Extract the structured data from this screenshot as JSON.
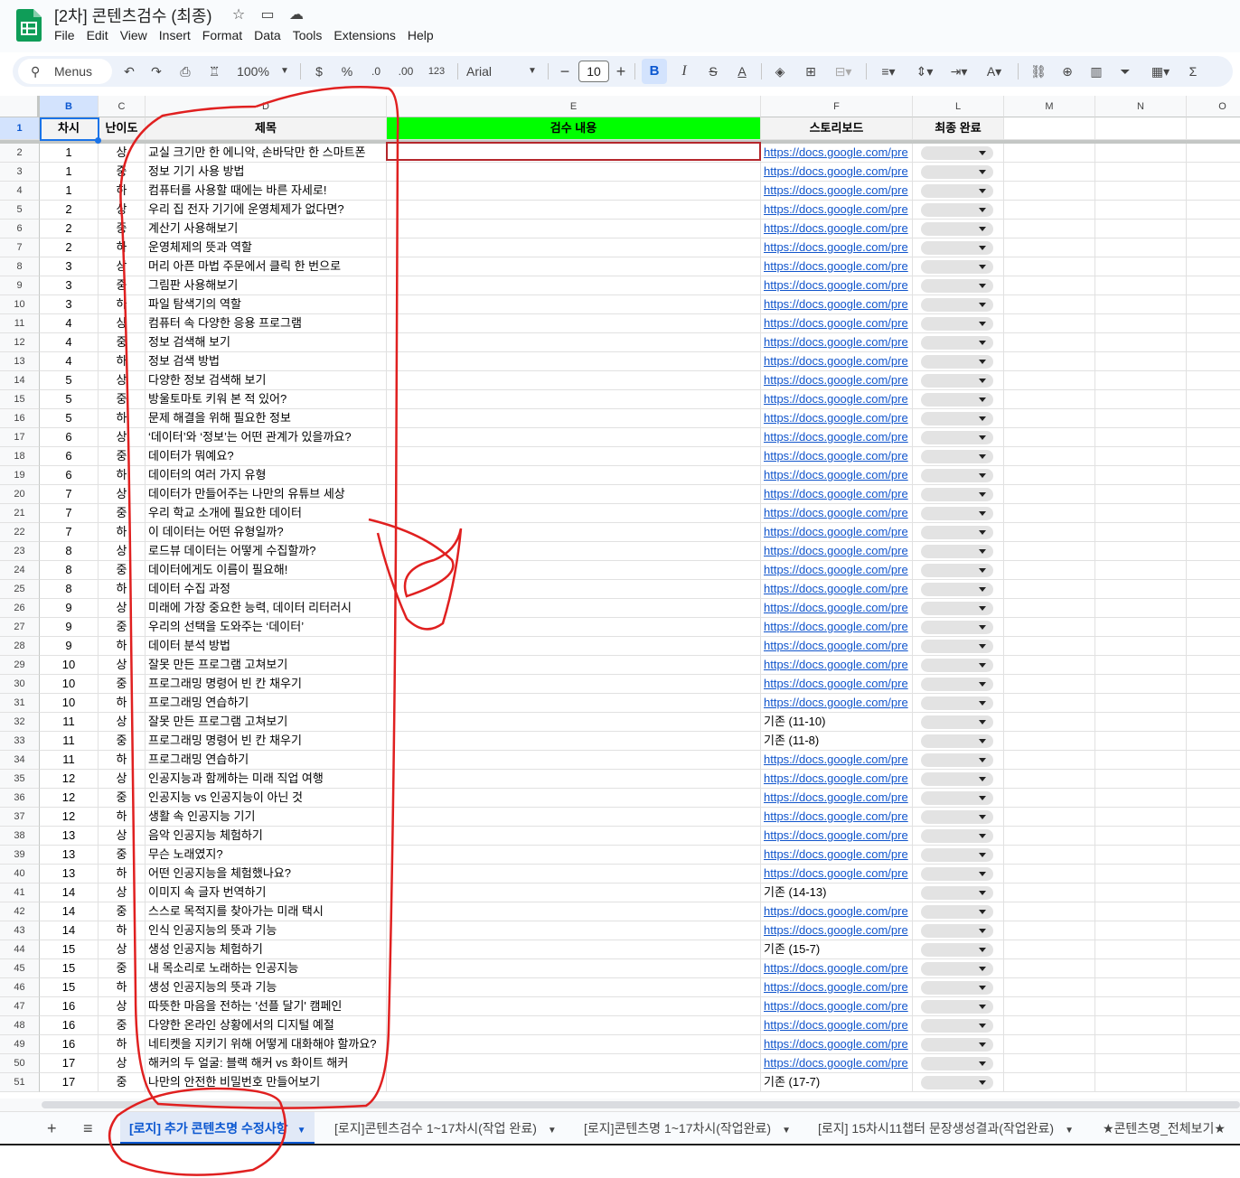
{
  "app": {
    "doc_title": "[2차] 콘텐츠검수 (최종)",
    "menu": [
      "File",
      "Edit",
      "View",
      "Insert",
      "Format",
      "Data",
      "Tools",
      "Extensions",
      "Help"
    ]
  },
  "toolbar": {
    "menus_label": "Menus",
    "zoom": "100%",
    "currency": "$",
    "percent": "%",
    "dec_decrease": ".0",
    "dec_increase": ".00",
    "number_format": "123",
    "font": "Arial",
    "font_size": "10",
    "minus": "−",
    "plus": "+",
    "bold": "B",
    "italic": "I",
    "strike": "S",
    "text_color": "A",
    "sum": "Σ"
  },
  "columns": [
    "B",
    "C",
    "D",
    "E",
    "F",
    "L",
    "M",
    "N",
    "O"
  ],
  "header_row": {
    "row_num": "1",
    "chasi": "차시",
    "level": "난이도",
    "title": "제목",
    "review": "검수 내용",
    "storyboard": "스토리보드",
    "final": "최종 완료"
  },
  "link_text": "https://docs.google.com/pre",
  "rows": [
    {
      "n": "2",
      "chasi": "1",
      "level": "상",
      "title": "교실 크기만 한 에니악, 손바닥만 한 스마트폰",
      "sb": "link"
    },
    {
      "n": "3",
      "chasi": "1",
      "level": "중",
      "title": "정보 기기 사용 방법",
      "sb": "link"
    },
    {
      "n": "4",
      "chasi": "1",
      "level": "하",
      "title": "컴퓨터를 사용할 때에는 바른 자세로!",
      "sb": "link"
    },
    {
      "n": "5",
      "chasi": "2",
      "level": "상",
      "title": "우리 집 전자 기기에 운영체제가 없다면?",
      "sb": "link"
    },
    {
      "n": "6",
      "chasi": "2",
      "level": "중",
      "title": "계산기 사용해보기",
      "sb": "link"
    },
    {
      "n": "7",
      "chasi": "2",
      "level": "하",
      "title": "운영체제의 뜻과 역할",
      "sb": "link"
    },
    {
      "n": "8",
      "chasi": "3",
      "level": "상",
      "title": "머리 아픈 마법 주문에서 클릭 한 번으로",
      "sb": "link"
    },
    {
      "n": "9",
      "chasi": "3",
      "level": "중",
      "title": "그림판 사용해보기",
      "sb": "link"
    },
    {
      "n": "10",
      "chasi": "3",
      "level": "하",
      "title": "파일 탐색기의 역할",
      "sb": "link"
    },
    {
      "n": "11",
      "chasi": "4",
      "level": "상",
      "title": "컴퓨터 속 다양한 응용 프로그램",
      "sb": "link"
    },
    {
      "n": "12",
      "chasi": "4",
      "level": "중",
      "title": "정보 검색해 보기",
      "sb": "link"
    },
    {
      "n": "13",
      "chasi": "4",
      "level": "하",
      "title": "정보 검색 방법",
      "sb": "link"
    },
    {
      "n": "14",
      "chasi": "5",
      "level": "상",
      "title": "다양한 정보 검색해 보기",
      "sb": "link"
    },
    {
      "n": "15",
      "chasi": "5",
      "level": "중",
      "title": "방울토마토 키워 본 적 있어?",
      "sb": "link"
    },
    {
      "n": "16",
      "chasi": "5",
      "level": "하",
      "title": "문제 해결을 위해 필요한 정보",
      "sb": "link"
    },
    {
      "n": "17",
      "chasi": "6",
      "level": "상",
      "title": "‘데이터’와 ‘정보’는 어떤 관계가 있을까요?",
      "sb": "link"
    },
    {
      "n": "18",
      "chasi": "6",
      "level": "중",
      "title": "데이터가 뭐예요?",
      "sb": "link"
    },
    {
      "n": "19",
      "chasi": "6",
      "level": "하",
      "title": "데이터의 여러 가지 유형",
      "sb": "link"
    },
    {
      "n": "20",
      "chasi": "7",
      "level": "상",
      "title": "데이터가 만들어주는 나만의 유튜브 세상",
      "sb": "link"
    },
    {
      "n": "21",
      "chasi": "7",
      "level": "중",
      "title": "우리 학교 소개에 필요한 데이터",
      "sb": "link"
    },
    {
      "n": "22",
      "chasi": "7",
      "level": "하",
      "title": "이 데이터는 어떤 유형일까?",
      "sb": "link"
    },
    {
      "n": "23",
      "chasi": "8",
      "level": "상",
      "title": "로드뷰 데이터는 어떻게 수집할까?",
      "sb": "link"
    },
    {
      "n": "24",
      "chasi": "8",
      "level": "중",
      "title": "데이터에게도 이름이 필요해!",
      "sb": "link"
    },
    {
      "n": "25",
      "chasi": "8",
      "level": "하",
      "title": "데이터 수집 과정",
      "sb": "link"
    },
    {
      "n": "26",
      "chasi": "9",
      "level": "상",
      "title": "미래에 가장 중요한 능력, 데이터 리터러시",
      "sb": "link"
    },
    {
      "n": "27",
      "chasi": "9",
      "level": "중",
      "title": "우리의 선택을 도와주는 ‘데이터’",
      "sb": "link"
    },
    {
      "n": "28",
      "chasi": "9",
      "level": "하",
      "title": "데이터 분석 방법",
      "sb": "link"
    },
    {
      "n": "29",
      "chasi": "10",
      "level": "상",
      "title": "잘못 만든 프로그램 고쳐보기",
      "sb": "link"
    },
    {
      "n": "30",
      "chasi": "10",
      "level": "중",
      "title": "프로그래밍 명령어 빈 칸 채우기",
      "sb": "link"
    },
    {
      "n": "31",
      "chasi": "10",
      "level": "하",
      "title": "프로그래밍 연습하기",
      "sb": "link"
    },
    {
      "n": "32",
      "chasi": "11",
      "level": "상",
      "title": "잘못 만든 프로그램 고쳐보기",
      "sb": "기존 (11-10)"
    },
    {
      "n": "33",
      "chasi": "11",
      "level": "중",
      "title": "프로그래밍 명령어 빈 칸 채우기",
      "sb": "기존 (11-8)"
    },
    {
      "n": "34",
      "chasi": "11",
      "level": "하",
      "title": "프로그래밍 연습하기",
      "sb": "link"
    },
    {
      "n": "35",
      "chasi": "12",
      "level": "상",
      "title": "인공지능과 함께하는 미래 직업 여행",
      "sb": "link"
    },
    {
      "n": "36",
      "chasi": "12",
      "level": "중",
      "title": "인공지능 vs 인공지능이 아닌 것",
      "sb": "link"
    },
    {
      "n": "37",
      "chasi": "12",
      "level": "하",
      "title": "생활 속 인공지능 기기",
      "sb": "link"
    },
    {
      "n": "38",
      "chasi": "13",
      "level": "상",
      "title": "음악 인공지능 체험하기",
      "sb": "link"
    },
    {
      "n": "39",
      "chasi": "13",
      "level": "중",
      "title": "무슨 노래였지?",
      "sb": "link"
    },
    {
      "n": "40",
      "chasi": "13",
      "level": "하",
      "title": "어떤 인공지능을 체험했나요?",
      "sb": "link"
    },
    {
      "n": "41",
      "chasi": "14",
      "level": "상",
      "title": "이미지 속 글자 번역하기",
      "sb": "기존 (14-13)"
    },
    {
      "n": "42",
      "chasi": "14",
      "level": "중",
      "title": "스스로 목적지를 찾아가는 미래 택시",
      "sb": "link"
    },
    {
      "n": "43",
      "chasi": "14",
      "level": "하",
      "title": "인식 인공지능의 뜻과 기능",
      "sb": "link"
    },
    {
      "n": "44",
      "chasi": "15",
      "level": "상",
      "title": "생성 인공지능 체험하기",
      "sb": "기존 (15-7)"
    },
    {
      "n": "45",
      "chasi": "15",
      "level": "중",
      "title": "내 목소리로 노래하는 인공지능",
      "sb": "link"
    },
    {
      "n": "46",
      "chasi": "15",
      "level": "하",
      "title": "생성 인공지능의 뜻과 기능",
      "sb": "link"
    },
    {
      "n": "47",
      "chasi": "16",
      "level": "상",
      "title": "따뜻한 마음을 전하는 '선플 달기' 캠페인",
      "sb": "link"
    },
    {
      "n": "48",
      "chasi": "16",
      "level": "중",
      "title": "다양한 온라인 상황에서의 디지털 예절",
      "sb": "link"
    },
    {
      "n": "49",
      "chasi": "16",
      "level": "하",
      "title": "네티켓을 지키기 위해 어떻게 대화해야 할까요?",
      "sb": "link"
    },
    {
      "n": "50",
      "chasi": "17",
      "level": "상",
      "title": "해커의 두 얼굴: 블랙 해커 vs 화이트 해커",
      "sb": "link"
    },
    {
      "n": "51",
      "chasi": "17",
      "level": "중",
      "title": "나만의 안전한 비밀번호 만들어보기",
      "sb": "기존 (17-7)"
    }
  ],
  "sheet_tabs": [
    "[로지] 추가 콘텐츠명 수정사항",
    "[로지]콘텐츠검수 1~17차시(작업 완료)",
    "[로지]콘텐츠명 1~17차시(작업완료)",
    "[로지] 15차시11챕터 문장생성결과(작업완료)",
    "★콘텐츠명_전체보기★"
  ],
  "colors": {
    "review_header": "#00ff00",
    "link": "#1155cc",
    "annotation": "#e02020",
    "active_tab": "#0b57d0"
  },
  "icons": [
    "sheets-logo-icon",
    "star-icon",
    "move-folder-icon",
    "cloud-status-icon",
    "search-icon",
    "undo-icon",
    "redo-icon",
    "print-icon",
    "paint-format-icon",
    "chevron-down-icon",
    "fill-color-icon",
    "borders-icon",
    "merge-icon",
    "align-icon",
    "valign-icon",
    "wrap-icon",
    "rotate-icon",
    "link-icon",
    "comment-icon",
    "chart-icon",
    "filter-icon",
    "table-view-icon",
    "add-sheet-icon",
    "all-sheets-icon"
  ]
}
